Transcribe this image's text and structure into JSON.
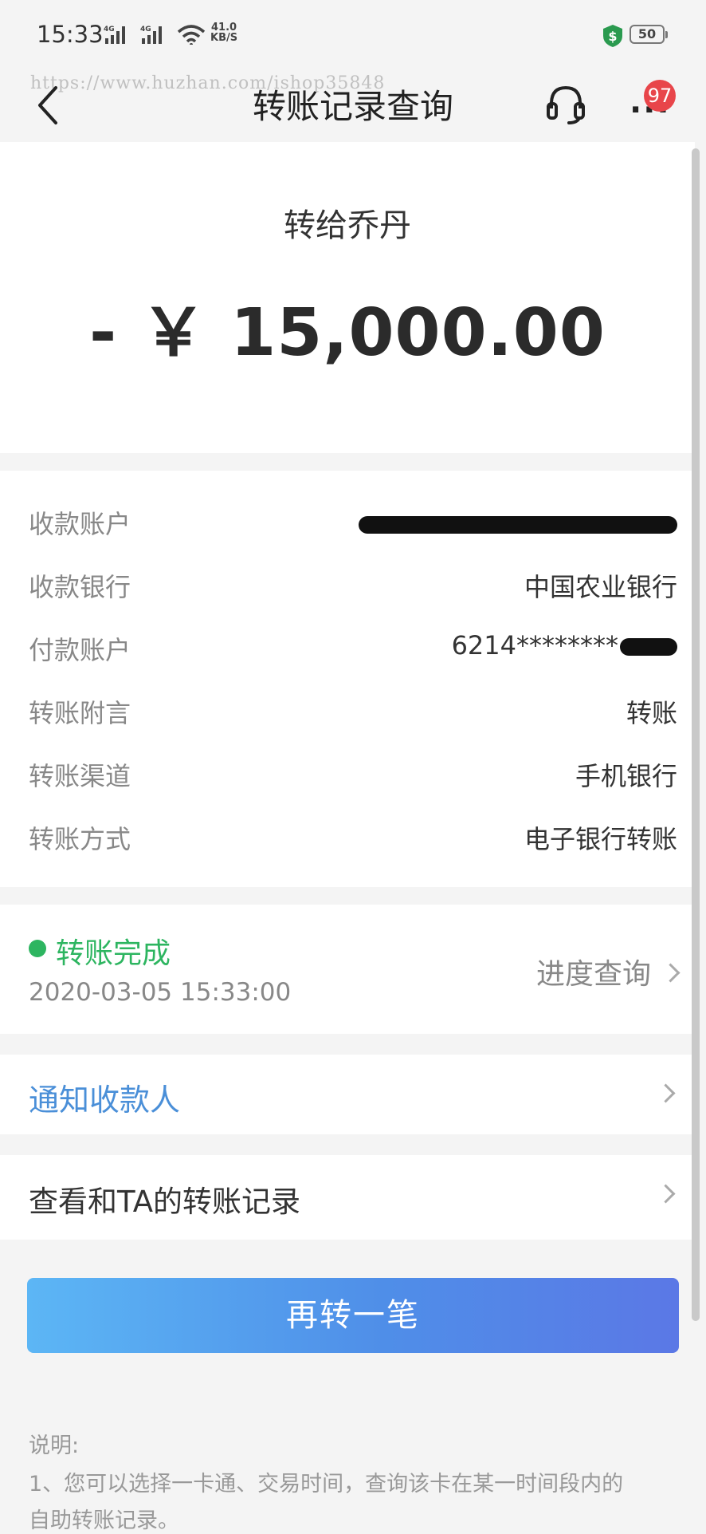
{
  "status_bar": {
    "time": "15:33",
    "network_speed_value": "41.0",
    "network_speed_unit": "KB/S",
    "battery": "50",
    "signal_label_1": "4G",
    "signal_label_2": "4G"
  },
  "navbar": {
    "title": "转账记录查询",
    "watermark": "https://www.huzhan.com/ishop35848",
    "notification_count": "97"
  },
  "summary": {
    "recipient": "转给乔丹",
    "amount": "- ￥ 15,000.00"
  },
  "details": [
    {
      "label": "收款账户",
      "value": ""
    },
    {
      "label": "收款银行",
      "value": "中国农业银行"
    },
    {
      "label": "付款账户",
      "value": "6214********"
    },
    {
      "label": "转账附言",
      "value": "转账"
    },
    {
      "label": "转账渠道",
      "value": "手机银行"
    },
    {
      "label": "转账方式",
      "value": "电子银行转账"
    }
  ],
  "status": {
    "text": "转账完成",
    "time": "2020-03-05 15:33:00",
    "progress_link": "进度查询",
    "color": "#2db560"
  },
  "notify_recipient": "通知收款人",
  "history_link": "查看和TA的转账记录",
  "cta_label": "再转一笔",
  "note": {
    "title": "说明:",
    "line1": "1、您可以选择一卡通、交易时间，查询该卡在某一时间段内的",
    "line2": "自助转账记录。"
  },
  "colors": {
    "accent_blue": "#4a8fd8",
    "success_green": "#2db560",
    "badge_red": "#e8454a"
  }
}
